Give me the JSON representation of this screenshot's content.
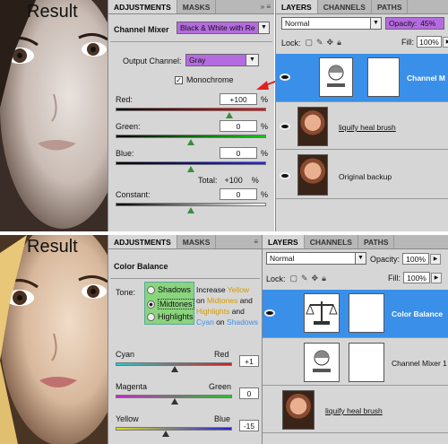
{
  "top": {
    "result_label": "Result",
    "adj_tabs": [
      "ADJUSTMENTS",
      "MASKS"
    ],
    "adj_title": "Channel Mixer",
    "preset_value": "Black & White with Re",
    "output_channel_label": "Output Channel:",
    "output_channel_value": "Gray",
    "monochrome_label": "Monochrome",
    "monochrome_checked": "✓",
    "red_label": "Red:",
    "red_value": "+100",
    "green_label": "Green:",
    "green_value": "0",
    "blue_label": "Blue:",
    "blue_value": "0",
    "total_label": "Total:",
    "total_value": "+100",
    "constant_label": "Constant:",
    "constant_value": "0",
    "pct": "%",
    "sliders": {
      "red": 0.6,
      "green": 0.5,
      "blue": 0.5,
      "constant": 0.5
    },
    "layers_tabs": [
      "LAYERS",
      "CHANNELS",
      "PATHS"
    ],
    "blend_mode": "Normal",
    "opacity_label": "Opacity:",
    "opacity_value": "45%",
    "lock_label": "Lock:",
    "fill_label": "Fill:",
    "fill_value": "100%",
    "layers": [
      {
        "name": "Channel M"
      },
      {
        "name": "liquify heal brush"
      },
      {
        "name": "Original backup"
      }
    ]
  },
  "bottom": {
    "result_label": "Result",
    "adj_tabs": [
      "ADJUSTMENTS",
      "MASKS"
    ],
    "adj_title": "Color Balance",
    "tone_label": "Tone:",
    "tones": [
      "Shadows",
      "Midtones",
      "Highlights"
    ],
    "tone_hint_1": [
      "Increase ",
      "Yellow"
    ],
    "tone_hint_2": [
      "on ",
      "Midtones",
      " and"
    ],
    "tone_hint_3": [
      "Highlights",
      " and"
    ],
    "tone_hint_4": [
      "Cyan",
      " on ",
      "Shadows"
    ],
    "cyan_label": "Cyan",
    "red_label": "Red",
    "cyan_red_value": "+1",
    "magenta_label": "Magenta",
    "green_label": "Green",
    "magenta_green_value": "0",
    "yellow_label": "Yellow",
    "blue_label": "Blue",
    "yellow_blue_value": "-15",
    "sliders": {
      "cyan_red": 0.5,
      "magenta_green": 0.5,
      "yellow_blue": 0.43
    },
    "layers_tabs": [
      "LAYERS",
      "CHANNELS",
      "PATHS"
    ],
    "blend_mode": "Normal",
    "opacity_label": "Opacity:",
    "opacity_value": "100%",
    "lock_label": "Lock:",
    "fill_label": "Fill:",
    "fill_value": "100%",
    "layers": [
      {
        "name": "Color Balance"
      },
      {
        "name": "Channel Mixer 1"
      },
      {
        "name": "liquify heal brush"
      }
    ]
  },
  "colors": {
    "purple_select": "#b56be0",
    "layer_selected": "#3a8fe8",
    "tone_green": "#8bd47e",
    "hint_yellow": "#d49a00",
    "hint_blue": "#3a8fe8"
  }
}
